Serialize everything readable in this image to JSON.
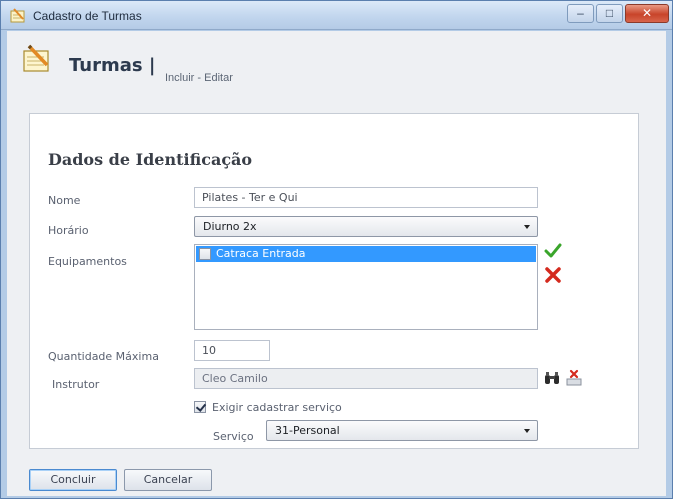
{
  "window": {
    "title": "Cadastro de Turmas",
    "controls": {
      "minimize": "‒",
      "maximize": "□",
      "close": "✕"
    }
  },
  "header": {
    "title": "Turmas |",
    "subtitle": "Incluir - Editar",
    "icon": "notepad-pencil-icon"
  },
  "form": {
    "section_title": "Dados de Identificação",
    "nome": {
      "label": "Nome",
      "value": "Pilates - Ter e Qui"
    },
    "horario": {
      "label": "Horário",
      "selected": "Diurno 2x"
    },
    "equipamentos": {
      "label": "Equipamentos",
      "items": [
        {
          "label": "Catraca Entrada",
          "checked": false,
          "selected": true
        }
      ],
      "confirm_icon": "green-check-icon",
      "remove_icon": "red-x-icon"
    },
    "quantidade": {
      "label": "Quantidade Máxima",
      "value": "10"
    },
    "instrutor": {
      "label": "Instrutor",
      "value": "Cleo Camilo",
      "search_icon": "binoculars-icon",
      "clear_icon": "clear-field-icon"
    },
    "exigir_servico": {
      "label": "Exigir cadastrar serviço",
      "checked": true
    },
    "servico": {
      "label": "Serviço",
      "selected": "31-Personal"
    }
  },
  "footer": {
    "concluir_label": "Concluir",
    "cancelar_label": "Cancelar"
  },
  "colors": {
    "selection": "#3399ff",
    "check_green": "#3aa52b",
    "remove_red": "#d42a1e",
    "desktop": "#1d4f86"
  }
}
